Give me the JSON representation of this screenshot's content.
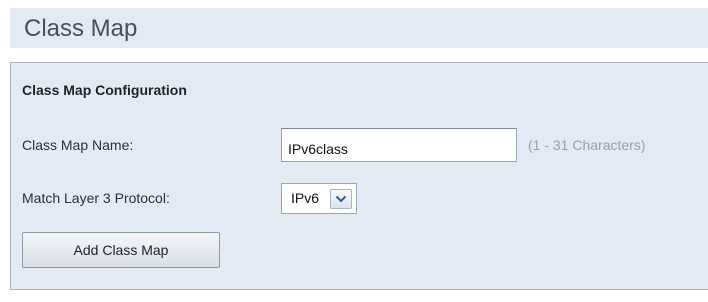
{
  "header": {
    "title": "Class Map"
  },
  "config": {
    "section_title": "Class Map Configuration",
    "name_field": {
      "label": "Class Map Name:",
      "value": "IPv6class",
      "hint": "(1 - 31 Characters)"
    },
    "protocol_field": {
      "label": "Match Layer 3 Protocol:",
      "selected": "IPv6"
    },
    "add_button": {
      "label": "Add Class Map"
    }
  },
  "colors": {
    "panel_background": "#e4eaf3",
    "panel_border": "#aab4c2",
    "hint_text": "#9aa0a8"
  },
  "icons": {
    "dropdown": "chevron-down-icon"
  }
}
